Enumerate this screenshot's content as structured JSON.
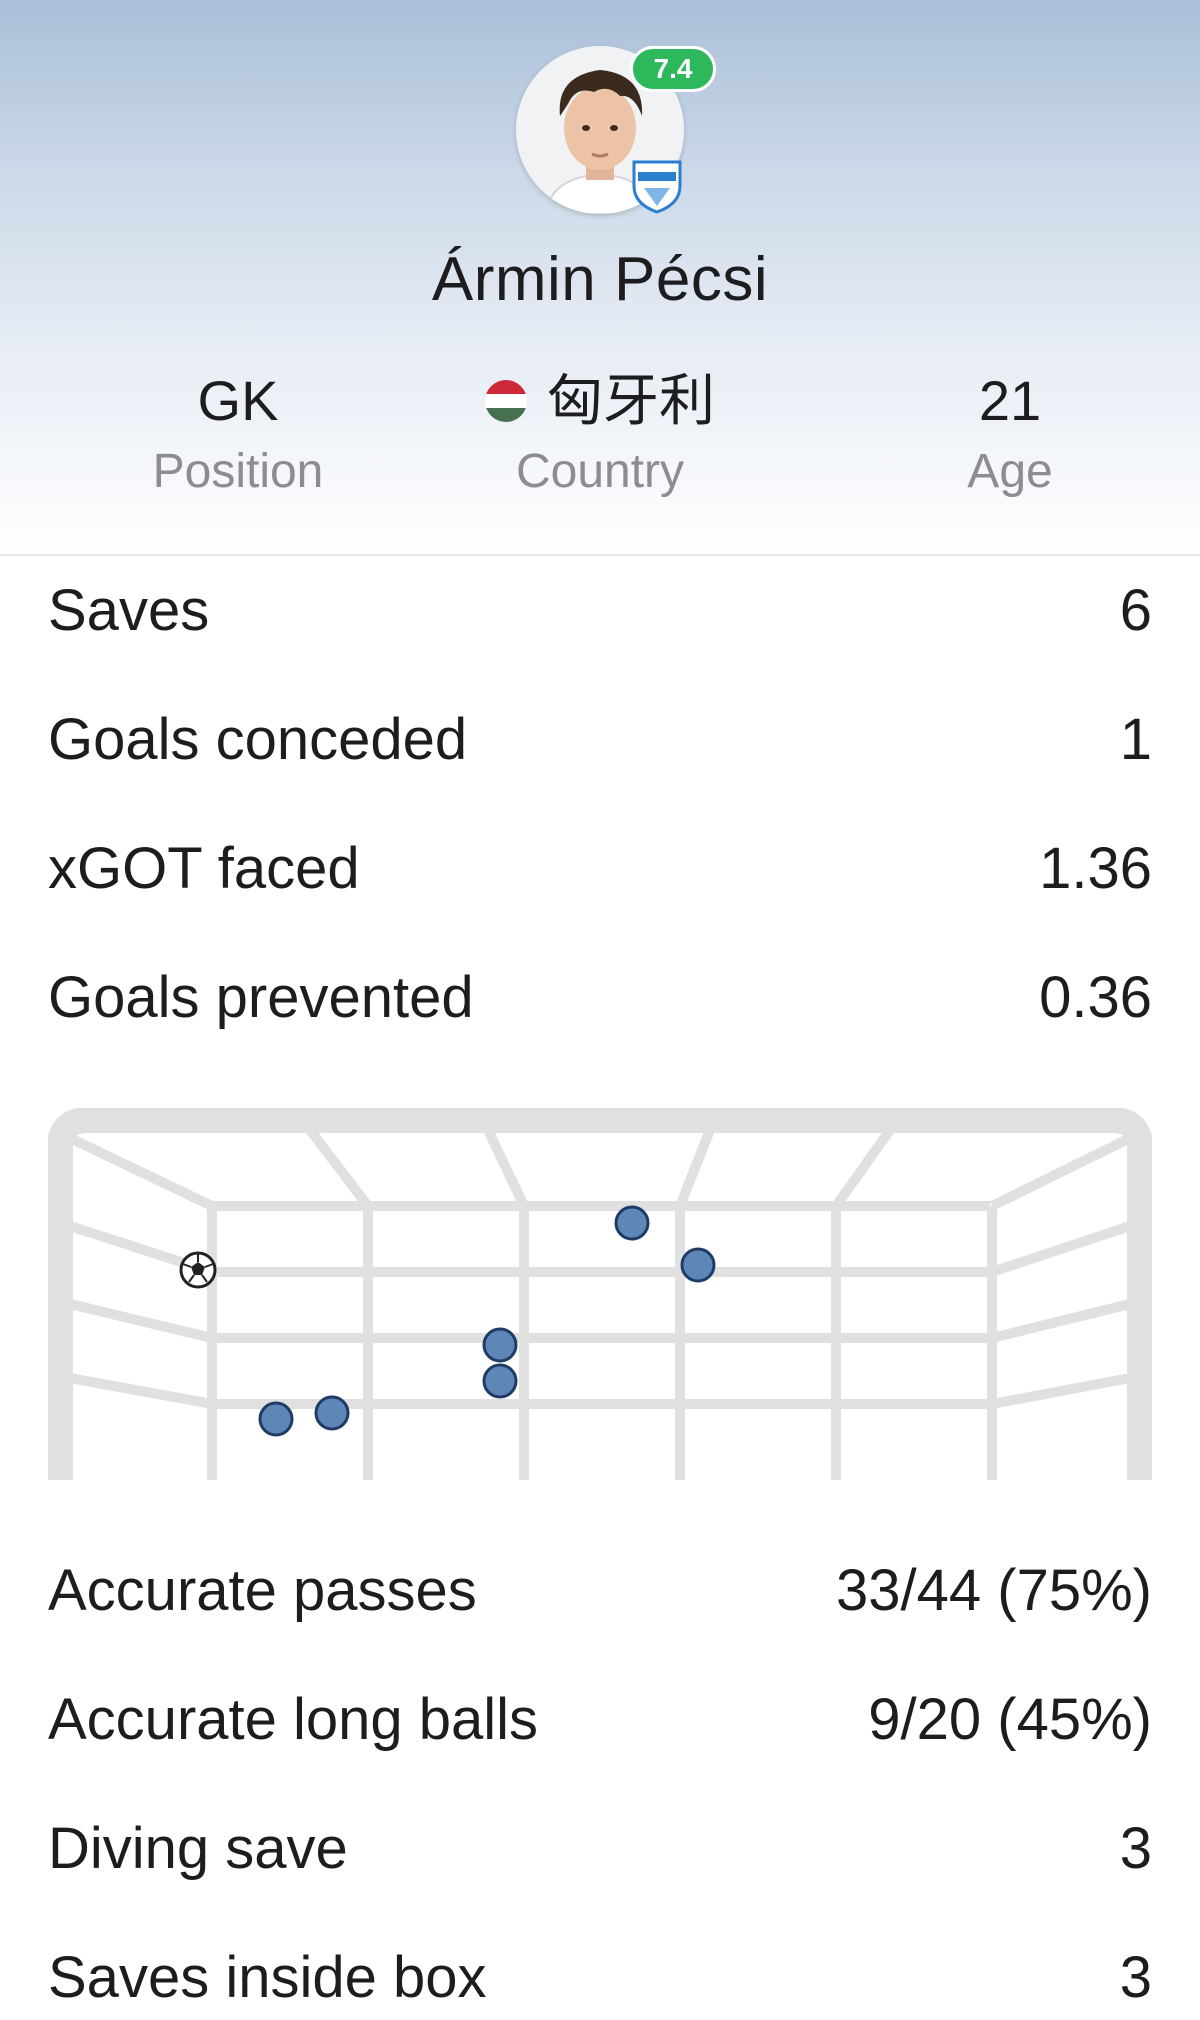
{
  "player": {
    "name": "Ármin Pécsi",
    "rating": "7.4",
    "position_value": "GK",
    "position_label": "Position",
    "country_value": "匈牙利",
    "country_label": "Country",
    "age_value": "21",
    "age_label": "Age"
  },
  "stats_top": [
    {
      "label": "Saves",
      "value": "6"
    },
    {
      "label": "Goals conceded",
      "value": "1"
    },
    {
      "label": "xGOT faced",
      "value": "1.36"
    },
    {
      "label": "Goals prevented",
      "value": "0.36"
    }
  ],
  "stats_bottom": [
    {
      "label": "Accurate passes",
      "value": "33/44 (75%)"
    },
    {
      "label": "Accurate long balls",
      "value": "9/20 (45%)"
    },
    {
      "label": "Diving save",
      "value": "3"
    },
    {
      "label": "Saves inside box",
      "value": "3"
    }
  ],
  "goal_map": {
    "saves": 6,
    "goals": 1
  },
  "colors": {
    "rating_badge": "#2eb85c",
    "save_marker": "#5e87b8",
    "save_marker_outline": "#1f3c66",
    "goal_frame": "#e0e0e0"
  },
  "icons": {
    "goal_ball": "soccer-ball-icon",
    "flag": "hungary-flag-icon",
    "club": "club-badge-icon"
  }
}
